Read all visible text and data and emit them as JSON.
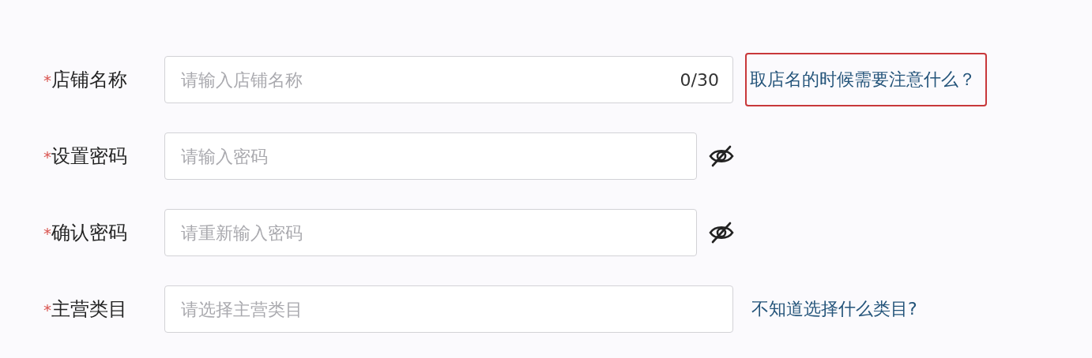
{
  "fields": [
    {
      "kind": "text",
      "mark": "*",
      "label": "店铺名称",
      "placeholder": "请输入店铺名称",
      "counter": "0/30",
      "help": {
        "text": "取店名的时候需要注意什么？",
        "highlighted": true
      }
    },
    {
      "kind": "password",
      "mark": "*",
      "label": "设置密码",
      "placeholder": "请输入密码"
    },
    {
      "kind": "password",
      "mark": "*",
      "label": "确认密码",
      "placeholder": "请重新输入密码"
    },
    {
      "kind": "select",
      "mark": "*",
      "label": "主营类目",
      "placeholder": "请选择主营类目",
      "help": {
        "text": "不知道选择什么类目?",
        "highlighted": false
      }
    }
  ]
}
